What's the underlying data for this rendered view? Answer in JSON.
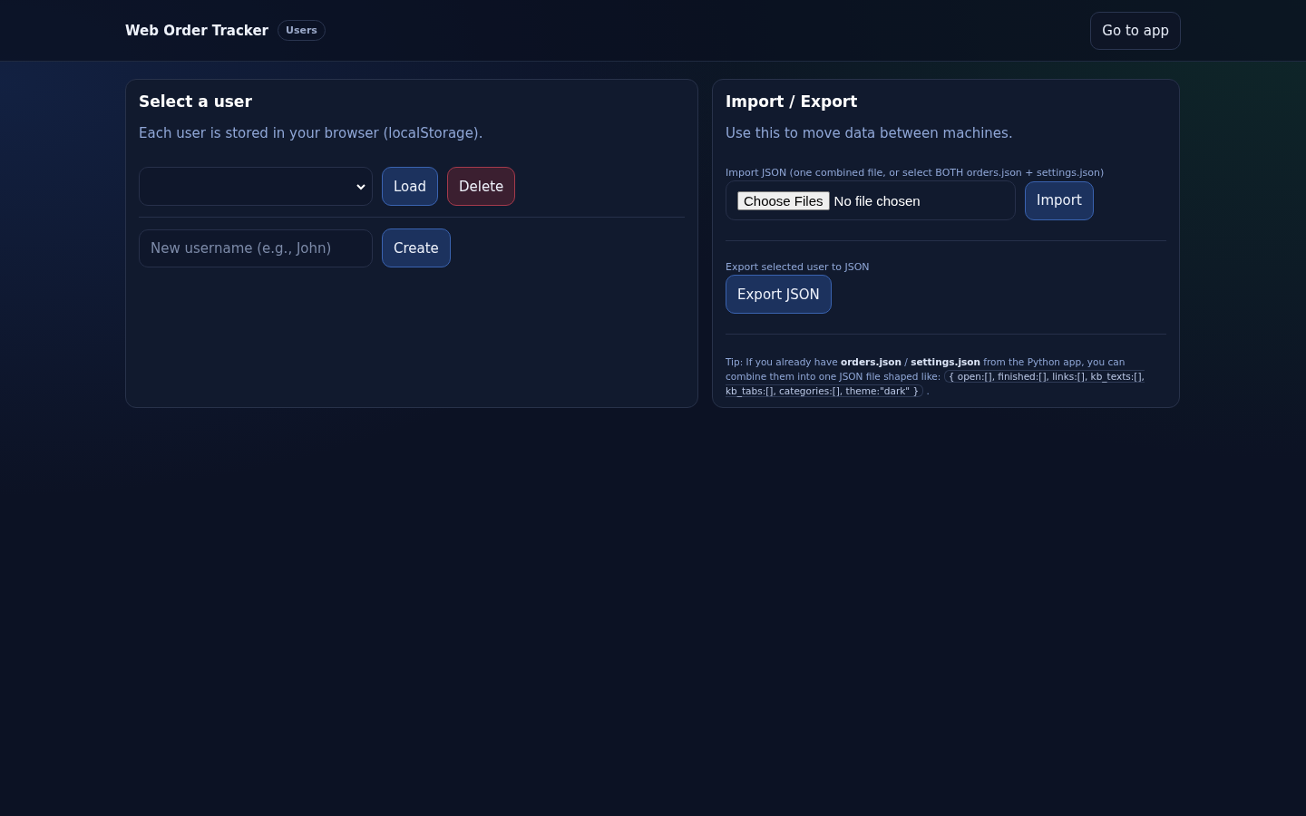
{
  "header": {
    "title": "Web Order Tracker",
    "badge": "Users",
    "action": "Go to app"
  },
  "user_panel": {
    "title": "Select a user",
    "description": "Each user is stored in your browser (localStorage).",
    "load_button": "Load",
    "delete_button": "Delete",
    "new_user": {
      "placeholder": "New username (e.g., John)"
    },
    "create_button": "Create"
  },
  "import_export_panel": {
    "title": "Import / Export",
    "description": "Use this to move data between machines.",
    "import_label": "Import JSON (one combined file, or select BOTH orders.json + settings.json)",
    "file_picker": {
      "button": "Choose Files",
      "status": "No file chosen"
    },
    "import_button": "Import",
    "export_label": "Export selected user to JSON",
    "export_button": "Export JSON",
    "tip": {
      "text": "Tip: If you already have **orders.json** / **settings.json** from the Python app, you can combine them into one JSON file shaped like:",
      "code": "{ open:[], finished:[], links:[], kb_texts:[], kb_tabs:[], categories:[], theme:\"dark\" }",
      "end": "."
    }
  }
}
